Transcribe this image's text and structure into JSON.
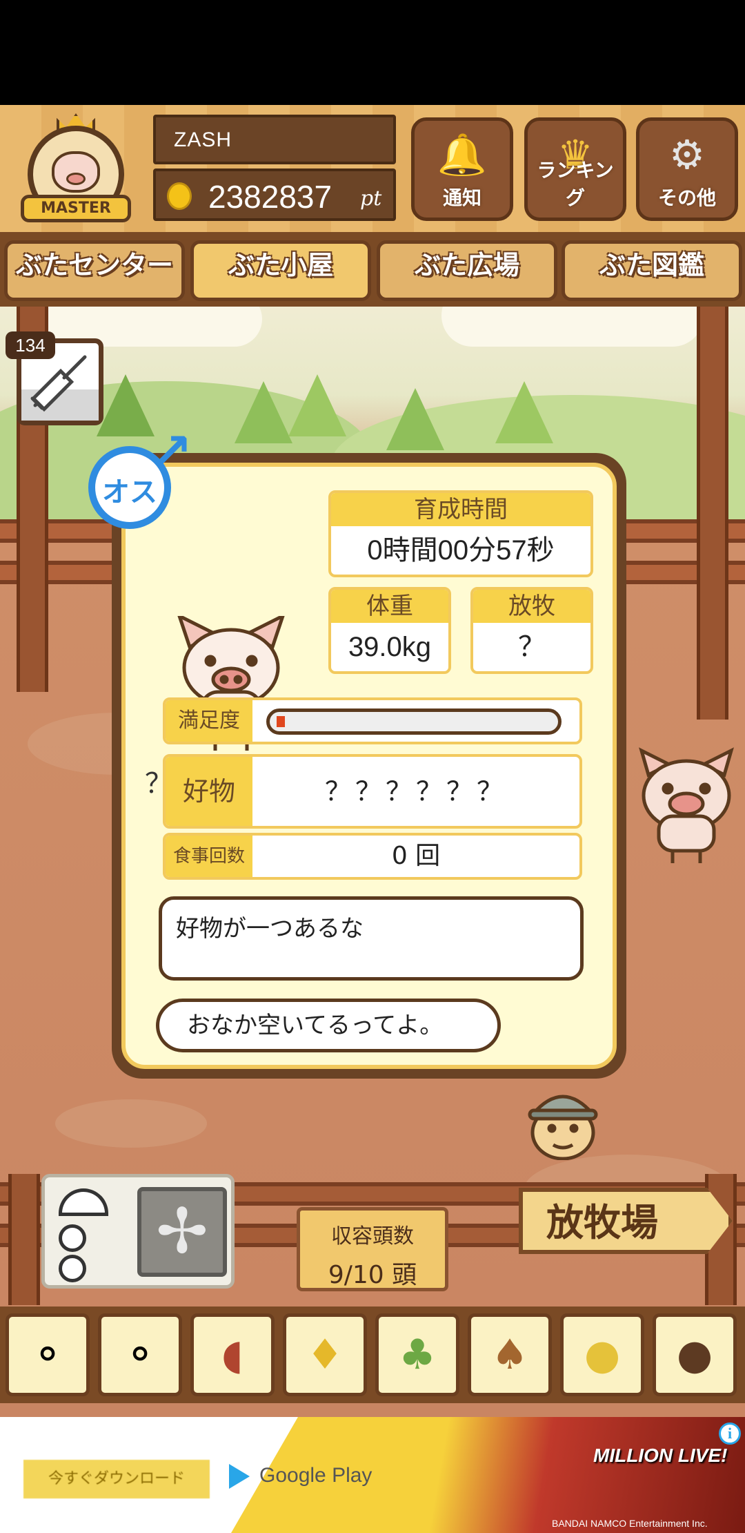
{
  "header": {
    "player_name": "ZASH",
    "points": "2382837",
    "points_unit": "pt",
    "badge_label": "MASTER",
    "buttons": [
      {
        "label": "通知",
        "icon": "bell-icon"
      },
      {
        "label": "ランキング",
        "icon": "crown-icon"
      },
      {
        "label": "その他",
        "icon": "gear-icon"
      }
    ]
  },
  "tabs": [
    "ぶたセンター",
    "ぶた小屋",
    "ぶた広場",
    "ぶた図鑑"
  ],
  "active_tab": "ぶた小屋",
  "syringe": {
    "count": "134"
  },
  "pig": {
    "gender": "オス",
    "name": "？？？？？",
    "raising_time_label": "育成時間",
    "raising_time": "0時間00分57秒",
    "weight_label": "体重",
    "weight": "39.0kg",
    "grazing_label": "放牧",
    "grazing": "？",
    "satisfaction_label": "満足度",
    "satisfaction_level": 0.03,
    "favorite_label": "好物",
    "favorite": "？？？？？？",
    "meals_label": "食事回数",
    "meals": "0 回"
  },
  "dialogue": {
    "hint": "好物が一つあるな",
    "status": "おなか空いてるってよ。"
  },
  "capacity": {
    "label": "収容頭数",
    "value": "9/10 頭"
  },
  "pasture_sign": "放牧場",
  "foods": [
    "grain-food-icon",
    "mixed-grain-food-icon",
    "sweet-potato-food-icon",
    "corn-food-icon",
    "beans-food-icon",
    "acorn-food-icon",
    "soybean-food-icon",
    "truffle-food-icon"
  ],
  "ad": {
    "download_label": "今すぐダウンロード",
    "store_label": "Google Play",
    "title": "MILLION LIVE!",
    "info": "i",
    "copyright": "BANDAI NAMCO Entertainment Inc."
  },
  "colors": {
    "panel_bg": "#fffbd3",
    "accent_yellow": "#f7d24a",
    "wood": "#7a4a25",
    "male_blue": "#2f8ce0",
    "meter_red": "#e0471e"
  }
}
